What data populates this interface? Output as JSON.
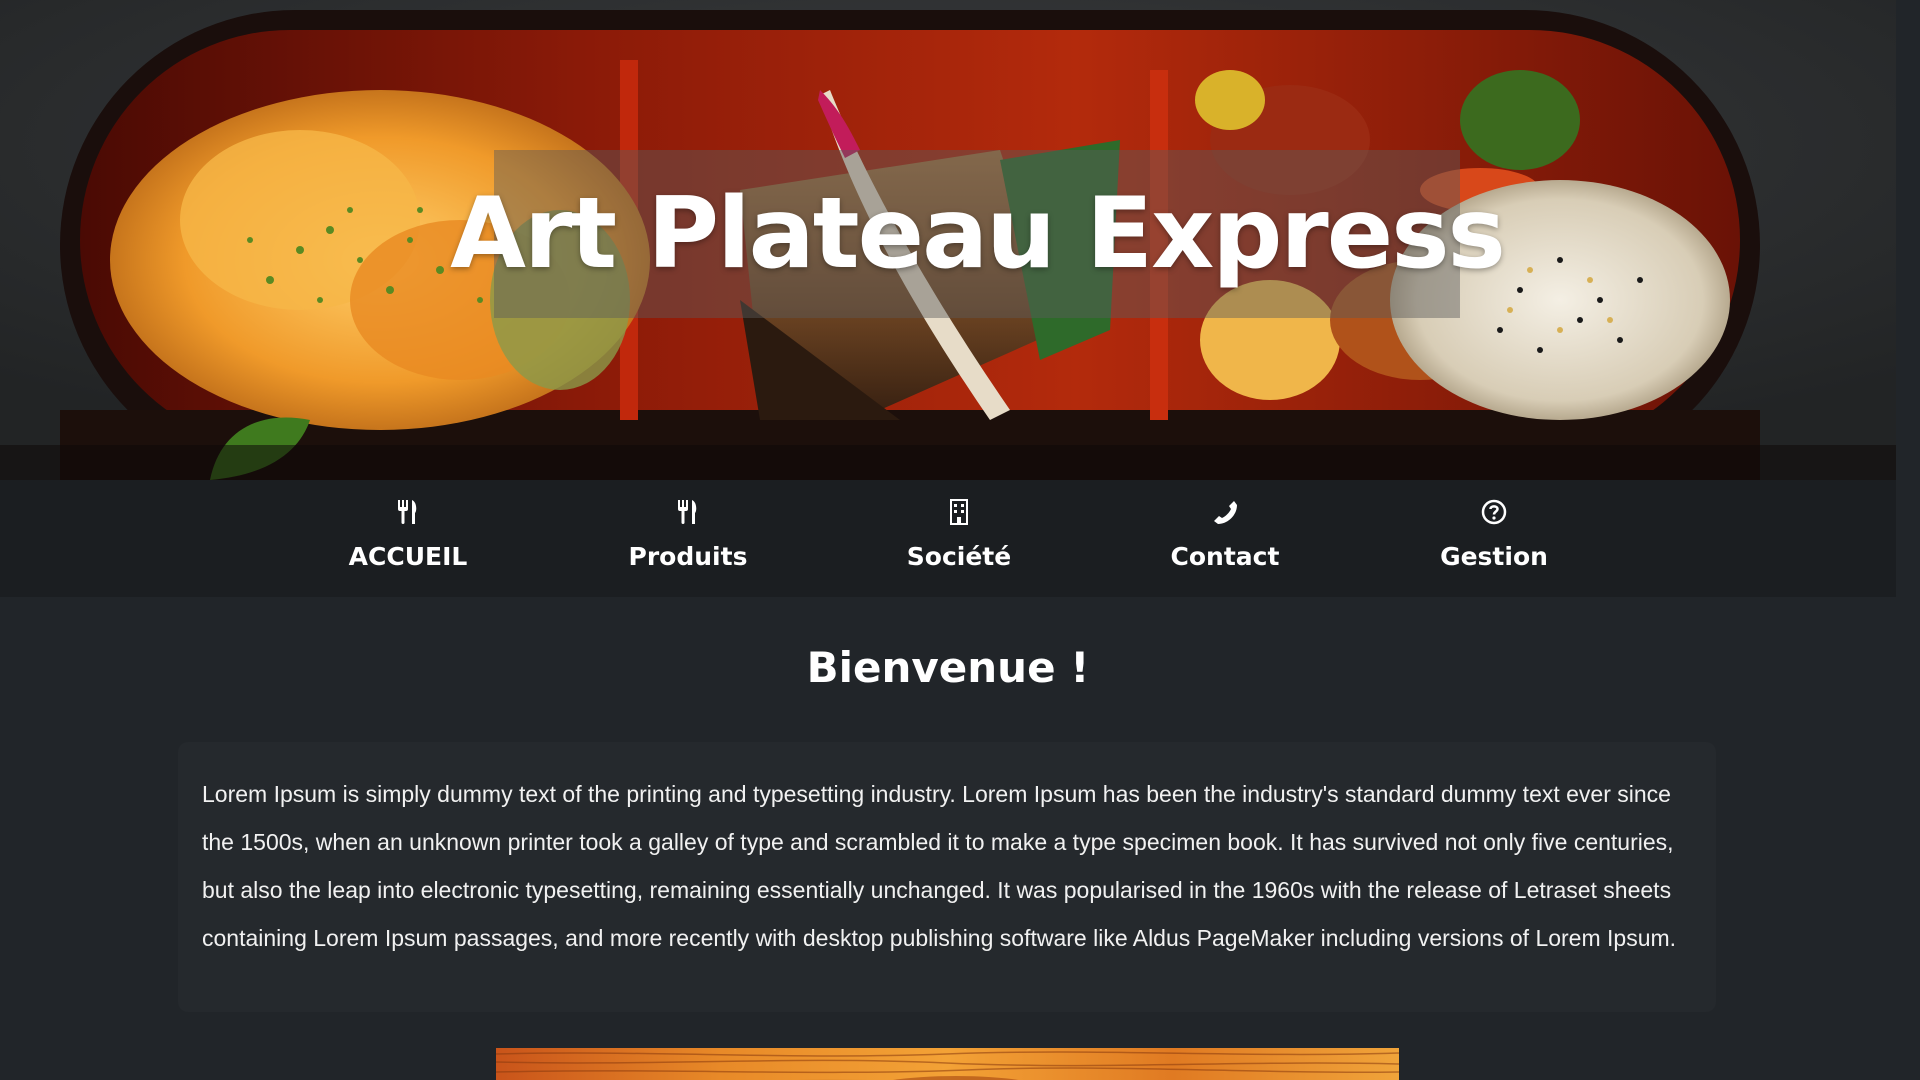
{
  "hero": {
    "title": "Art Plateau Express",
    "image_icon": "bento-food-photo"
  },
  "nav": {
    "items": [
      {
        "label": "ACCUEIL",
        "icon": "utensils-icon"
      },
      {
        "label": "Produits",
        "icon": "utensils-icon"
      },
      {
        "label": "Société",
        "icon": "building-icon"
      },
      {
        "label": "Contact",
        "icon": "phone-icon"
      },
      {
        "label": "Gestion",
        "icon": "question-circle-icon"
      }
    ]
  },
  "main": {
    "heading": "Bienvenue !",
    "intro": "Lorem Ipsum is simply dummy text of the printing and typesetting industry. Lorem Ipsum has been the industry's standard dummy text ever since the 1500s, when an unknown printer took a galley of type and scrambled it to make a type specimen book. It has survived not only five centuries, but also the leap into electronic typesetting, remaining essentially unchanged. It was popularised in the 1960s with the release of Letraset sheets containing Lorem Ipsum passages, and more recently with desktop publishing software like Aldus PageMaker including versions of Lorem Ipsum."
  },
  "colors": {
    "page_background": "#212529",
    "nav_background": "#1b1e21",
    "card_background": "#25292d",
    "text": "#ffffff",
    "scrollbar_thumb": "#c1c1c1"
  }
}
